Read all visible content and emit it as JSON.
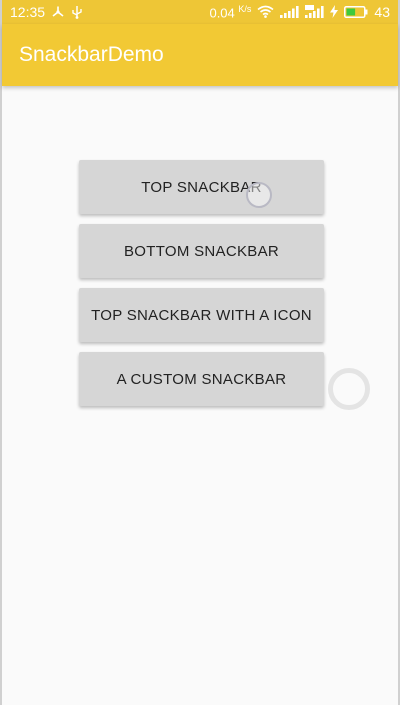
{
  "status_bar": {
    "time": "12:35",
    "net_speed": "0.04",
    "net_speed_unit": "K/s",
    "battery": "43",
    "left_icons": [
      "share-icon",
      "usb-icon"
    ],
    "right_icons": [
      "wifi-icon",
      "signal-icon",
      "4g-signal-icon",
      "charging-icon",
      "battery-icon"
    ]
  },
  "app_bar": {
    "title": "SnackbarDemo",
    "color": "#f2c934"
  },
  "buttons": [
    {
      "label": "TOP SNACKBAR"
    },
    {
      "label": "BOTTOM SNACKBAR"
    },
    {
      "label": "TOP SNACKBAR WITH A ICON"
    },
    {
      "label": "A CUSTOM SNACKBAR"
    }
  ],
  "colors": {
    "accent": "#f2c934",
    "button_bg": "#d6d6d6",
    "background": "#fafafa"
  }
}
